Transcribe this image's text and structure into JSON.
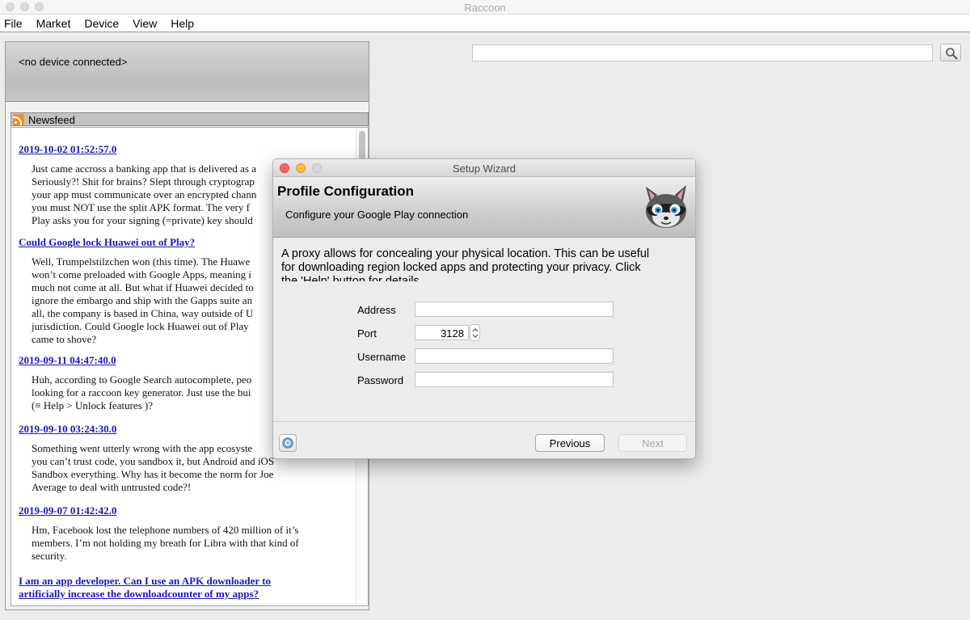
{
  "window": {
    "title": "Raccoon"
  },
  "menubar": {
    "items": [
      "File",
      "Market",
      "Device",
      "View",
      "Help"
    ]
  },
  "device": {
    "status": "<no device connected>"
  },
  "newsfeed": {
    "label": "Newsfeed",
    "items": [
      {
        "title": "2019-10-02 01:52:57.0",
        "lines": [
          "Just came accross a banking app that is delivered as a",
          "Seriously?! Shit for brains? Slept through cryptograp",
          "your app must communicate over an encrypted chann",
          "you must NOT use the split APK format. The very f",
          "Play asks you for your signing (=private) key should"
        ]
      },
      {
        "title": "Could Google lock Huawei out of Play?",
        "lines": [
          "Well, Trumpelstilzchen won (this time). The Huawe",
          "won’t come preloaded with Google Apps, meaning i",
          "much not come at all. But what if Huawei decided to",
          "ignore the embargo and ship with the Gapps suite an",
          "all, the company is based in China, way outside of U",
          "jurisdiction. Could Google lock Huawei out of Play",
          "came to shove?"
        ]
      },
      {
        "title": "2019-09-11 04:47:40.0",
        "lines": [
          "Huh, according to Google Search autocomplete, peo",
          "looking for a raccoon key generator. Just use the bui",
          "(≡ Help > Unlock features )?"
        ]
      },
      {
        "title": "2019-09-10 03:24:30.0",
        "lines": [
          "Something went utterly wrong with the app ecosyste",
          "you can’t trust code, you sandbox it, but Android and iOS",
          "Sandbox everything. Why has it become the norm for Joe",
          "Average to deal with untrusted code?!"
        ]
      },
      {
        "title": "2019-09-07 01:42:42.0",
        "lines": [
          "Hm, Facebook lost the telephone numbers of 420 million of it’s",
          "members. I’m not holding my breath for Libra with that kind of",
          "security."
        ]
      },
      {
        "title_lines": [
          "I am an app developer. Can I use an APK downloader to",
          "artificially increase the downloadcounter of my apps?"
        ]
      }
    ]
  },
  "search": {
    "value": "",
    "placeholder": ""
  },
  "wizard": {
    "title": "Setup Wizard",
    "heading": "Profile Configuration",
    "subheading": "Configure your Google Play connection",
    "description_lines": [
      "A proxy allows for concealing your physical location. This can be useful",
      "for downloading region locked apps and protecting your privacy. Click",
      "the 'Help' button for details."
    ],
    "fields": {
      "address_label": "Address",
      "address_value": "",
      "port_label": "Port",
      "port_value": "3128",
      "username_label": "Username",
      "username_value": "",
      "password_label": "Password",
      "password_value": ""
    },
    "buttons": {
      "previous": "Previous",
      "next": "Next"
    }
  },
  "colors": {
    "link": "#1a19b5",
    "rss": "#f58d1e",
    "close": "#fc605c",
    "minimize": "#fdbc40",
    "zoom_disabled": "#d6d6d6"
  }
}
